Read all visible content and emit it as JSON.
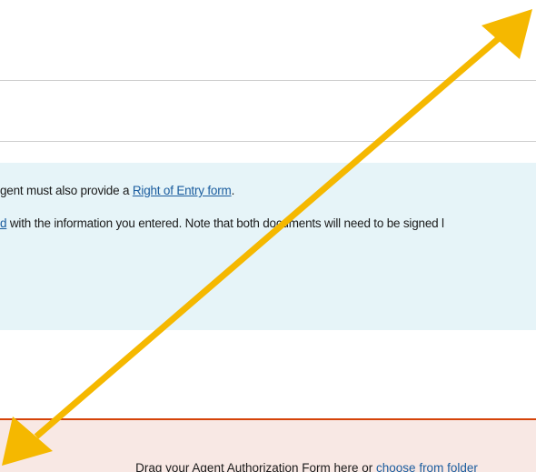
{
  "info": {
    "line1_prefix": "gent must also provide a ",
    "line1_link": "Right of Entry form",
    "line1_suffix": ".",
    "line2_link": "d",
    "line2_text": " with the information you entered. Note that both documents will need to be signed l"
  },
  "upload": {
    "prompt": "Drag your Agent Authorization Form here or ",
    "choose_link": "choose from folder"
  },
  "colors": {
    "info_background": "#e6f4f8",
    "upload_border": "#d54309",
    "upload_background": "#f8e8e4",
    "arrow": "#f5b800",
    "link": "#1a5c9e"
  },
  "overlay": {
    "icon": "double-headed-arrow-icon"
  }
}
